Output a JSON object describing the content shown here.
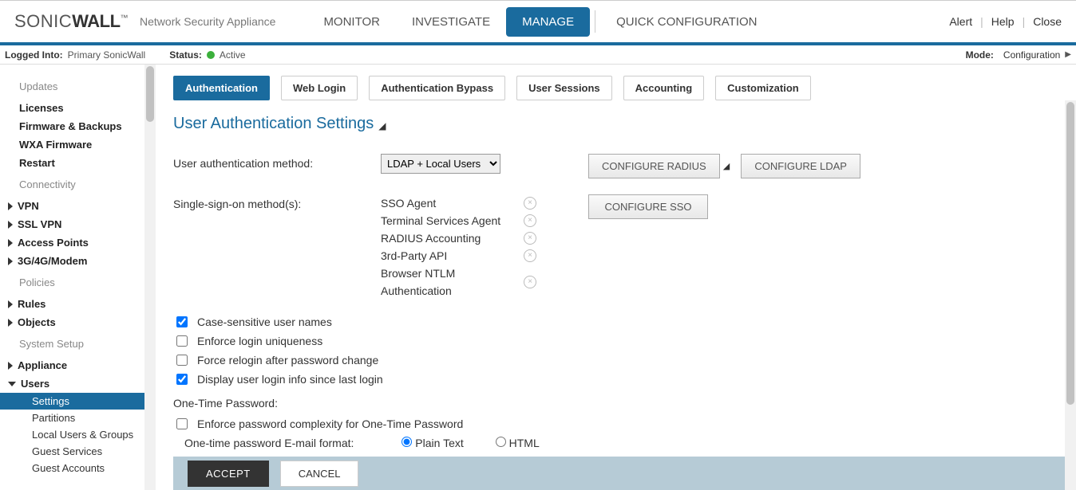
{
  "brand": {
    "part1": "SONIC",
    "part2": "WALL",
    "tm": "™"
  },
  "tagline": "Network Security Appliance",
  "main_nav": {
    "monitor": "MONITOR",
    "investigate": "INVESTIGATE",
    "manage": "MANAGE",
    "quickconfig": "QUICK CONFIGURATION"
  },
  "top_right": {
    "alert": "Alert",
    "help": "Help",
    "close": "Close"
  },
  "status_bar": {
    "logged_label": "Logged Into:",
    "logged_value": "Primary SonicWall",
    "status_label": "Status:",
    "status_value": "Active",
    "mode_label": "Mode:",
    "mode_value": "Configuration"
  },
  "sidebar": {
    "groups": {
      "updates": "Updates",
      "updates_items": {
        "licenses": "Licenses",
        "fw": "Firmware & Backups",
        "wxa": "WXA Firmware",
        "restart": "Restart"
      },
      "connectivity": "Connectivity",
      "conn_items": {
        "vpn": "VPN",
        "sslvpn": "SSL VPN",
        "ap": "Access Points",
        "modem": "3G/4G/Modem"
      },
      "policies": "Policies",
      "pol_items": {
        "rules": "Rules",
        "objects": "Objects"
      },
      "setup": "System Setup",
      "setup_items": {
        "appliance": "Appliance",
        "users": "Users",
        "users_sub": {
          "settings": "Settings",
          "partitions": "Partitions",
          "lug": "Local Users & Groups",
          "gs": "Guest Services",
          "ga": "Guest Accounts"
        }
      }
    }
  },
  "tabs": {
    "auth": "Authentication",
    "weblogin": "Web Login",
    "bypass": "Authentication Bypass",
    "sessions": "User Sessions",
    "accounting": "Accounting",
    "custom": "Customization"
  },
  "page": {
    "title": "User Authentication Settings",
    "auth_method_label": "User authentication method:",
    "auth_method_value": "LDAP + Local Users",
    "btn_radius": "CONFIGURE RADIUS",
    "btn_ldap": "CONFIGURE LDAP",
    "sso_label": "Single-sign-on method(s):",
    "sso_items": {
      "agent": "SSO Agent",
      "ts": "Terminal Services Agent",
      "radius": "RADIUS Accounting",
      "api": "3rd-Party API",
      "ntlm": "Browser NTLM Authentication"
    },
    "btn_sso": "CONFIGURE SSO",
    "chk": {
      "case": "Case-sensitive user names",
      "uniq": "Enforce login uniqueness",
      "relogin": "Force relogin after password change",
      "display": "Display user login info since last login"
    },
    "otp_heading": "One-Time Password:",
    "otp_complexity": "Enforce password complexity for One-Time Password",
    "otp_format_label": "One-time password E-mail format:",
    "otp_plain": "Plain Text",
    "otp_html": "HTML",
    "accept": "ACCEPT",
    "cancel": "CANCEL"
  }
}
